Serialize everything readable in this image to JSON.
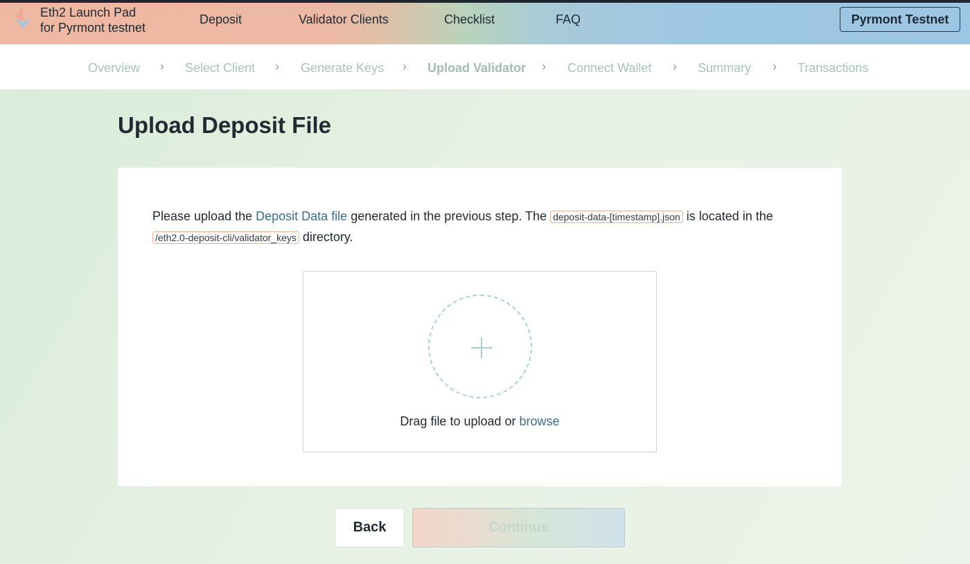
{
  "header": {
    "brand_line1": "Eth2 Launch Pad",
    "brand_line2": "for Pyrmont testnet",
    "nav": [
      "Deposit",
      "Validator Clients",
      "Checklist",
      "FAQ"
    ],
    "network_button": "Pyrmont Testnet"
  },
  "steps": {
    "items": [
      "Overview",
      "Select Client",
      "Generate Keys",
      "Upload Validator",
      "Connect Wallet",
      "Summary",
      "Transactions"
    ],
    "active": "Upload Validator",
    "separator": "›"
  },
  "page": {
    "title": "Upload Deposit File"
  },
  "card": {
    "text_before_link": "Please upload the ",
    "link_text": "Deposit Data file",
    "text_after_link": " generated in the previous step. The ",
    "file_code": "deposit-data-[timestamp].json",
    "text_after_file": " is located in the",
    "dir_code": "/eth2.0-deposit-cli/validator_keys",
    "text_after_dir": " directory.",
    "dropzone_text": "Drag file to upload or ",
    "browse_link": "browse"
  },
  "buttons": {
    "back": "Back",
    "continue": "Continue"
  },
  "colors": {
    "accent_link": "#3a6e8c",
    "step_inactive": "#a6c4b6",
    "code_border": "#e0b39a"
  }
}
